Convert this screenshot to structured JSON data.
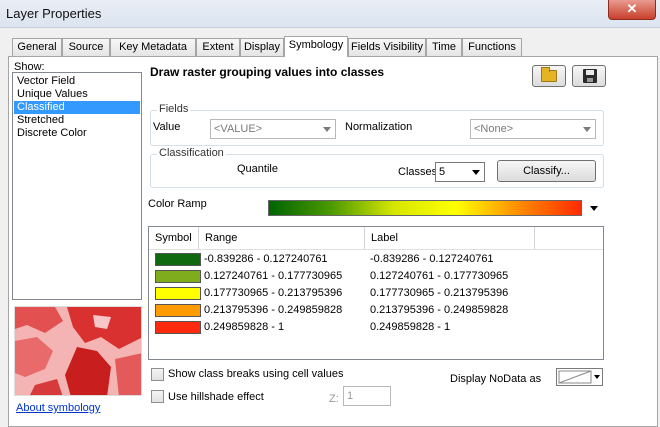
{
  "window": {
    "title": "Layer Properties",
    "close_glyph": "✕"
  },
  "tabs": [
    {
      "label": "General"
    },
    {
      "label": "Source"
    },
    {
      "label": "Key Metadata"
    },
    {
      "label": "Extent"
    },
    {
      "label": "Display"
    },
    {
      "label": "Symbology",
      "active": true
    },
    {
      "label": "Fields Visibility"
    },
    {
      "label": "Time"
    },
    {
      "label": "Functions"
    }
  ],
  "show_panel": {
    "label": "Show:",
    "items": [
      "Vector Field",
      "Unique Values",
      "Classified",
      "Stretched",
      "Discrete Color"
    ],
    "selected": "Classified",
    "about_link": "About symbology"
  },
  "header": {
    "description": "Draw raster grouping values into classes"
  },
  "toolbar": {
    "open_icon": "folder-open-icon",
    "save_icon": "save-disk-icon"
  },
  "fields": {
    "legend": "Fields",
    "value_label": "Value",
    "value_selected": "<VALUE>",
    "normalization_label": "Normalization",
    "normalization_selected": "<None>"
  },
  "classification": {
    "legend": "Classification",
    "method": "Quantile",
    "classes_label": "Classes",
    "classes_value": "5",
    "classify_button": "Classify..."
  },
  "color_ramp": {
    "label": "Color Ramp",
    "stops": [
      "#006400",
      "#4c9a00",
      "#d6e600",
      "#ffff00",
      "#ff8c00",
      "#ff2a00"
    ]
  },
  "symbol_table": {
    "headers": {
      "symbol": "Symbol",
      "range": "Range",
      "label": "Label"
    },
    "rows": [
      {
        "color": "#0f6a0f",
        "range": "-0.839286 - 0.127240761",
        "label": "-0.839286 - 0.127240761"
      },
      {
        "color": "#7fac1c",
        "range": "0.127240761 - 0.177730965",
        "label": "0.127240761 - 0.177730965"
      },
      {
        "color": "#ffff00",
        "range": "0.177730965 - 0.213795396",
        "label": "0.177730965 - 0.213795396"
      },
      {
        "color": "#ff9a00",
        "range": "0.213795396 - 0.249859828",
        "label": "0.213795396 - 0.249859828"
      },
      {
        "color": "#ff2a0e",
        "range": "0.249859828 - 1",
        "label": "0.249859828 - 1"
      }
    ]
  },
  "options": {
    "show_class_breaks_label": "Show class breaks using cell values",
    "use_hillshade_label": "Use hillshade effect",
    "z_label": "Z:",
    "z_value": "1",
    "nodata_label": "Display NoData as"
  }
}
